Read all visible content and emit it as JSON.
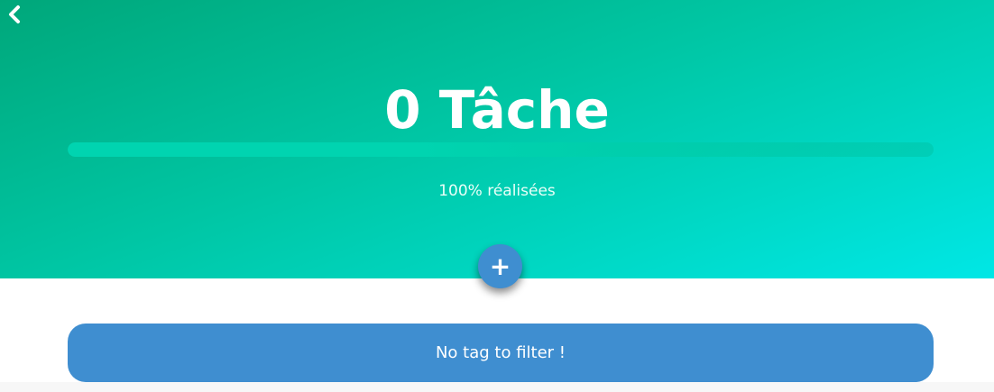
{
  "header": {
    "title": "0 Tâche",
    "progress_percent": 100,
    "progress_text": "100% réalisées",
    "back_icon": "chevron-left-icon"
  },
  "actions": {
    "add_label": "+",
    "add_icon": "plus-icon"
  },
  "filter": {
    "label": "No tag to filter !"
  },
  "colors": {
    "accent": "#3f8ed0",
    "gradient_start": "#00a77a",
    "gradient_end": "#00e7e6",
    "text": "#ffffff"
  }
}
